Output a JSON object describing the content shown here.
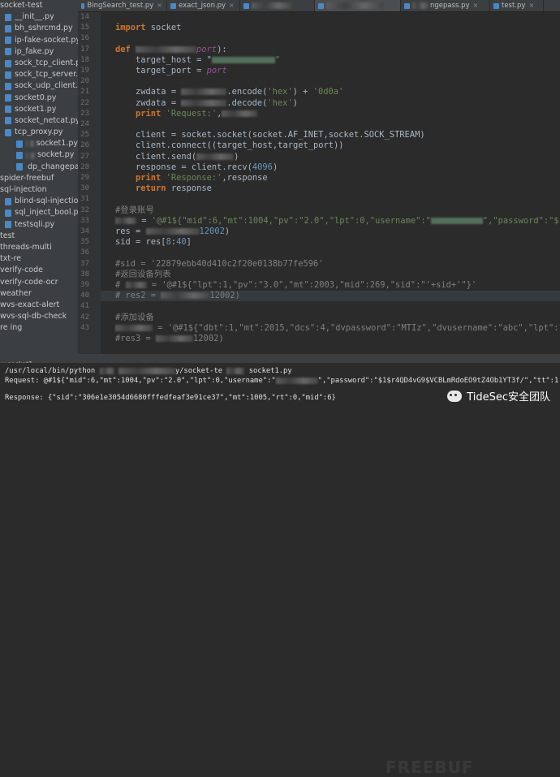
{
  "sidebar": {
    "items": [
      {
        "label": "socket-test",
        "type": "dir"
      },
      {
        "label": "__init__.py",
        "type": "py"
      },
      {
        "label": "bh_sshrcmd.py",
        "type": "py"
      },
      {
        "label": "ip-fake-socket.py",
        "type": "py"
      },
      {
        "label": "ip_fake.py",
        "type": "py"
      },
      {
        "label": "sock_tcp_client.py",
        "type": "py"
      },
      {
        "label": "sock_tcp_server.py",
        "type": "py"
      },
      {
        "label": "sock_udp_client.py",
        "type": "py"
      },
      {
        "label": "socket0.py",
        "type": "py"
      },
      {
        "label": "socket1.py",
        "type": "py"
      },
      {
        "label": "socket_netcat.py",
        "type": "py"
      },
      {
        "label": "tcp_proxy.py",
        "type": "py"
      },
      {
        "label": "socket1.py",
        "type": "py"
      },
      {
        "label": "socket.py",
        "type": "py"
      },
      {
        "label": "dp_changepa",
        "type": "py"
      },
      {
        "label": "spider-freebuf",
        "type": "dir"
      },
      {
        "label": "sql-injection",
        "type": "dir"
      },
      {
        "label": "blind-sql-injection",
        "type": "py"
      },
      {
        "label": "sql_inject_bool.py",
        "type": "py"
      },
      {
        "label": "testsqli.py",
        "type": "py"
      },
      {
        "label": "test",
        "type": "dir"
      },
      {
        "label": "threads-multi",
        "type": "dir"
      },
      {
        "label": "txt-re",
        "type": "dir"
      },
      {
        "label": "verify-code",
        "type": "dir"
      },
      {
        "label": "verify-code-ocr",
        "type": "dir"
      },
      {
        "label": "weather",
        "type": "dir"
      },
      {
        "label": "wvs-exact-alert",
        "type": "dir"
      },
      {
        "label": "wvs-sql-db-check",
        "type": "dir"
      },
      {
        "label": "re ing",
        "type": "dir"
      }
    ]
  },
  "tabs": [
    {
      "label": "BingSearch_test.py"
    },
    {
      "label": "exact_json.py"
    },
    {
      "label": ""
    },
    {
      "label": ""
    },
    {
      "label": "ngepass.py"
    },
    {
      "label": "test.py"
    }
  ],
  "tab_close_glyph": "×",
  "editor": {
    "line_numbers": [
      "14",
      "15",
      "16",
      "17",
      "18",
      "19",
      "20",
      "21",
      "22",
      "23",
      "24",
      "25",
      "26",
      "27",
      "28",
      "29",
      "30",
      "31",
      "32",
      "33",
      "34",
      "35",
      "36",
      "37",
      "38",
      "39",
      "40",
      "41",
      "42",
      "43"
    ]
  },
  "code": {
    "l15_import": "import",
    "l15_mod": " socket",
    "l17_def": "def ",
    "l17_param": "port",
    "l17_tail": "):",
    "l18_a": "    target_host = \"",
    "l18_b": "\"",
    "l19_a": "    target_port = ",
    "l19_b": "port",
    "l21_a": "    zwdata = ",
    "l21_b": ".encode(",
    "l21_c": "'hex'",
    "l21_d": ") + ",
    "l21_e": "'0d0a'",
    "l22_a": "    zwdata = ",
    "l22_b": ".decode(",
    "l22_c": "'hex'",
    "l22_d": ")",
    "l23_a": "    print ",
    "l23_b": "'Request:'",
    "l23_c": ",",
    "l25": "    client = socket.socket(socket.AF_INET,socket.SOCK_STREAM)",
    "l26": "    client.connect((target_host,target_port))",
    "l27": "    client.send(",
    "l27_end": ")",
    "l28_a": "    response = client.recv(",
    "l28_b": "4096",
    "l28_c": ")",
    "l29_a": "    print ",
    "l29_b": "'Response:'",
    "l29_c": ",response",
    "l30_a": "    return",
    "l30_b": " response",
    "l32": "#登录账号",
    "l33_a": " = ",
    "l33_b": "'@#1${\"mid\":6,\"mt\":1004,\"pv\":\"2.0\",\"lpt\":0,\"username\":\"",
    "l33_c": "\",\"password\":\"$1",
    "l34_a": "res = ",
    "l34_b": "12002",
    "l34_c": ")",
    "l35_a": "sid = res[",
    "l35_b": "8",
    "l35_c": ":",
    "l35_d": "40",
    "l35_e": "]",
    "l37": "#sid = '22879ebb40d410c2f20e0138b77fe596'",
    "l38": "#返回设备列表",
    "l39_a": "# ",
    "l39_b": " = '@#1${\"lpt\":1,\"pv\":\"3.0\",\"mt\":2003,\"mid\":269,\"sid\":\"'+sid+'\"}'",
    "l40_a": "# res2 = ",
    "l40_b": "12002)",
    "l42": "#添加设备",
    "l43_a": " = '@#1${\"dbt\":1,\"mt\":2015,\"dcs\":4,\"dvpassword\":\"MTIz\",\"dvusername\":\"abc\",\"lpt\":1,\"p",
    "l44_a": "#res3 = ",
    "l44_b": "12002)"
  },
  "run_bar": {
    "label": "v-socket1"
  },
  "console": {
    "cmd_a": "/usr/local/bin/python ",
    "cmd_b": "y/socket-te",
    "cmd_c": "socket1.py",
    "req_a": "Request: @#1${\"mid\":6,\"mt\":1004,\"pv\":\"2.0\",\"lpt\":0,\"username\":\"",
    "req_b": "\",\"password\":\"$1$r4QD4vG9$VCBLmRdoEO9tZ4Ob1YT3f/\",\"tt\":1",
    "resp": "Response: {\"sid\":\"306e1e3054d6680fffedfeaf3e91ce37\",\"mt\":1005,\"rt\":0,\"mid\":6}"
  },
  "watermark": {
    "label": "TideSec安全团队",
    "bg_text": "FREEBUF"
  }
}
